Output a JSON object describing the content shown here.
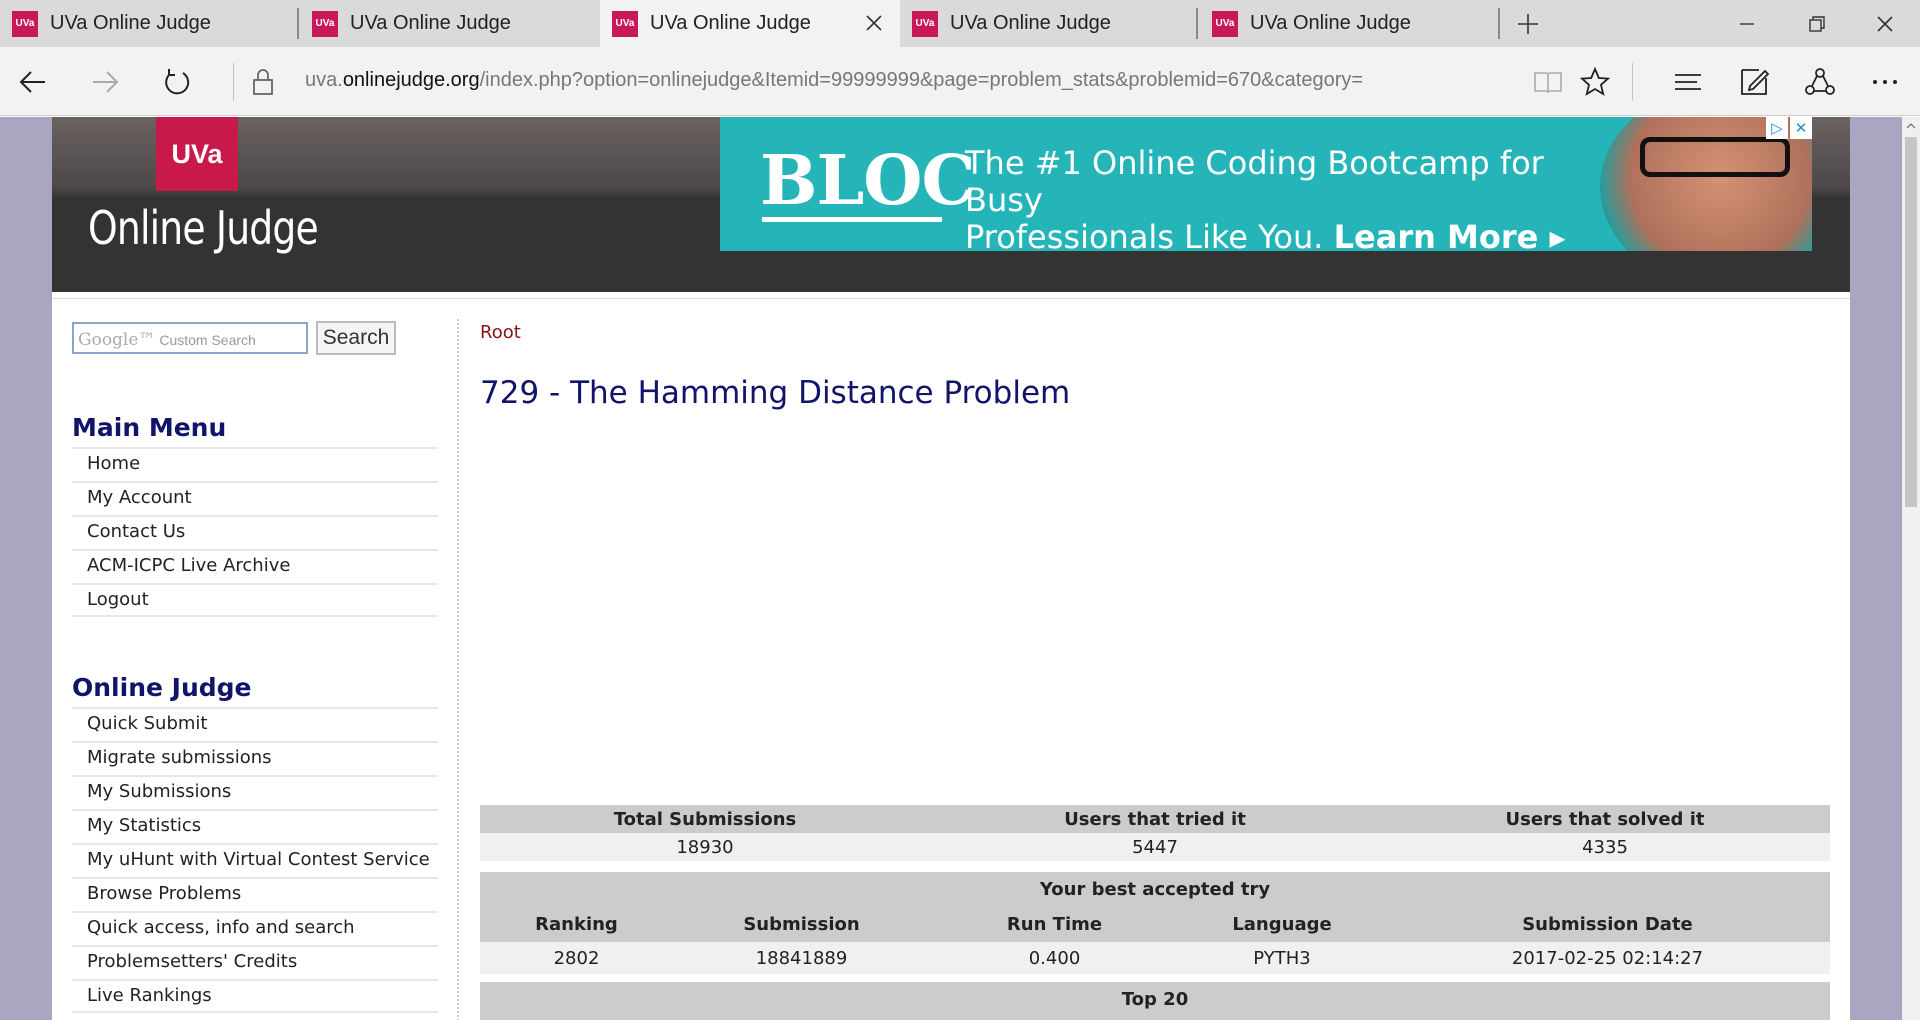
{
  "browser": {
    "tabs": [
      {
        "favicon": "UVa",
        "label": "UVa Online Judge",
        "active": false
      },
      {
        "favicon": "UVa",
        "label": "UVa Online Judge",
        "active": false
      },
      {
        "favicon": "UVa",
        "label": "UVa Online Judge",
        "active": true
      },
      {
        "favicon": "UVa",
        "label": "UVa Online Judge",
        "active": false
      },
      {
        "favicon": "UVa",
        "label": "UVa Online Judge",
        "active": false
      }
    ],
    "url_prefix": "uva.",
    "url_domain": "onlinejudge.org",
    "url_path": "/index.php?option=onlinejudge&Itemid=99999999&page=problem_stats&problemid=670&category="
  },
  "header": {
    "logo_badge": "UVa",
    "logo_text": "Online Judge",
    "ad": {
      "brand": "BLOC",
      "line1": "The #1 Online Coding Bootcamp for Busy",
      "line2_plain": "Professionals Like You. ",
      "line2_bold": "Learn More ▸",
      "icon_adchoices": "▷",
      "icon_close": "✕"
    }
  },
  "sidebar": {
    "search_placeholder_brand": "Google™",
    "search_placeholder": "Custom Search",
    "search_button": "Search",
    "main_menu_title": "Main Menu",
    "main_menu": [
      "Home",
      "My Account",
      "Contact Us",
      "ACM-ICPC Live Archive",
      "Logout"
    ],
    "judge_menu_title": "Online Judge",
    "judge_menu": [
      "Quick Submit",
      "Migrate submissions",
      "My Submissions",
      "My Statistics",
      "My uHunt with Virtual Contest Service",
      "Browse Problems",
      "Quick access, info and search",
      "Problemsetters' Credits",
      "Live Rankings"
    ]
  },
  "content": {
    "breadcrumb": "Root",
    "problem_title": "729 - The Hamming Distance Problem",
    "summary": {
      "headers": [
        "Total Submissions",
        "Users that tried it",
        "Users that solved it"
      ],
      "values": [
        "18930",
        "5447",
        "4335"
      ]
    },
    "best_try": {
      "title": "Your best accepted try",
      "headers": [
        "Ranking",
        "Submission",
        "Run Time",
        "Language",
        "Submission Date"
      ],
      "values": [
        "2802",
        "18841889",
        "0.400",
        "PYTH3",
        "2017-02-25 02:14:27"
      ]
    },
    "top20_title": "Top 20"
  }
}
